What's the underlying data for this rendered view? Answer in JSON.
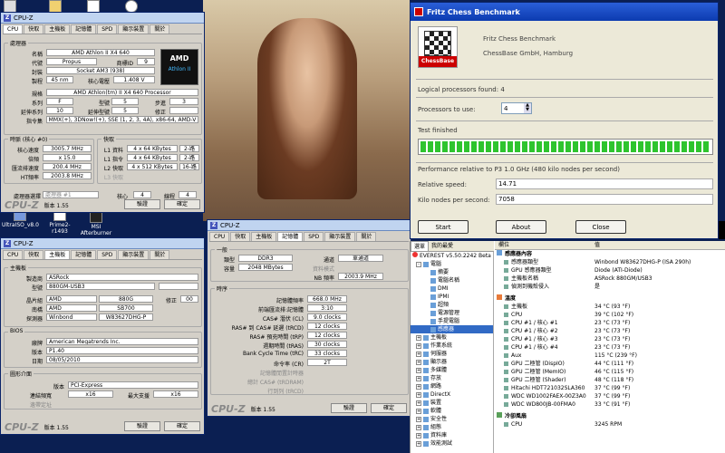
{
  "desktop": {
    "icons": [
      "UltraISO_v8.0",
      "Prime2-r1493",
      "MSI\nAfterburner"
    ],
    "top_icons": [
      "",
      "",
      "",
      ""
    ]
  },
  "cpuz1": {
    "title": "CPU-Z",
    "tabs": [
      "CPU",
      "快取",
      "主機板",
      "記憶體",
      "SPD",
      "顯示裝置",
      "關於"
    ],
    "proc_title": "處理器",
    "name_l": "名稱",
    "name": "AMD Athlon II X4 640",
    "code_l": "代號",
    "code": "Propus",
    "brand_l": "商標ID",
    "brand": "9",
    "pkg_l": "封裝",
    "pkg": "Socket AM3 (938)",
    "tech_l": "製程",
    "tech": "45 nm",
    "volt_l": "核心電壓",
    "volt": "1.408 V",
    "spec_l": "規格",
    "spec": "AMD Athlon(tm) II X4 640 Processor",
    "fam_l": "系列",
    "fam": "F",
    "model_l": "型號",
    "model": "5",
    "step_l": "步進",
    "step": "3",
    "efam_l": "延伸系列",
    "efam": "10",
    "emod_l": "延伸型號",
    "emod": "5",
    "rev_l": "修正",
    "rev": "",
    "inst_l": "指令集",
    "inst": "MMX(+), 3DNow!(+), SSE (1, 2, 3, 4A), x86-64, AMD-V",
    "clk_title": "時脈 (核心 #0)",
    "cs_l": "核心速度",
    "cs": "3005.7 MHz",
    "mult_l": "倍頻",
    "mult": "x 15.0",
    "bus_l": "匯流排速度",
    "bus": "200.4 MHz",
    "ht_l": "HT頻率",
    "ht": "2003.8 MHz",
    "cache_title": "快取",
    "l1d_l": "L1 資料",
    "l1d": "4 x 64 KBytes",
    "l1d_w": "2-路",
    "l1i_l": "L1 指令",
    "l1i": "4 x 64 KBytes",
    "l1i_w": "2-路",
    "l2_l": "L2 快取",
    "l2": "4 x 512 KBytes",
    "l2_w": "16-路",
    "l3_l": "L3 快取",
    "sel_l": "處理器選擇",
    "sel": "處理器 #1",
    "cores_l": "核心",
    "cores": "4",
    "thr_l": "線程",
    "thr": "4",
    "logo": "CPU-Z",
    "version": "版本 1.55",
    "validate": "驗證",
    "ok": "確定",
    "amd_logo": "AMD",
    "athlon": "Athlon II"
  },
  "cpuz2": {
    "title": "CPU-Z",
    "tabs": [
      "CPU",
      "快取",
      "主機板",
      "記憶體",
      "SPD",
      "顯示裝置",
      "關於"
    ],
    "mb_title": "主機板",
    "mfr_l": "製造商",
    "mfr": "ASRock",
    "model_l": "型號",
    "model": "880GM-USB3",
    "model_r": "",
    "chip_l": "晶片組",
    "chip": "AMD",
    "chip2": "880G",
    "rev_l": "修正",
    "rev": "00",
    "sb_l": "南橋",
    "sb": "AMD",
    "sb2": "SB700",
    "lpc_l": "探測器",
    "lpc": "Winbond",
    "lpc2": "W83627DHG-P",
    "bios_title": "BIOS",
    "brand_l": "廠牌",
    "brand": "American Megatrends Inc.",
    "ver_l": "版本",
    "ver": "P1.40",
    "date_l": "日期",
    "date": "08/05/2010",
    "gi_title": "圖形介面",
    "gv_l": "版本",
    "gv": "PCI-Express",
    "lw_l": "連結頻寬",
    "lw": "x16",
    "mx_l": "最大支援",
    "mx": "x16",
    "sb2_l": "邊帶定址",
    "logo": "CPU-Z",
    "version": "版本 1.55",
    "validate": "驗證",
    "ok": "確定"
  },
  "cpuz3": {
    "title": "CPU-Z",
    "tabs": [
      "CPU",
      "快取",
      "主機板",
      "記憶體",
      "SPD",
      "顯示裝置",
      "關於"
    ],
    "gen_title": "一般",
    "type_l": "類型",
    "type": "DDR3",
    "ch_l": "通道",
    "ch": "單通道",
    "size_l": "容量",
    "size": "2048 MBytes",
    "dc_l": "資料模式",
    "nb_l": "NB 頻率",
    "nb": "2003.9 MHz",
    "tim_title": "時序",
    "dram_l": "記憶體頻率",
    "dram": "668.0 MHz",
    "fsb_l": "前端匯流排:記憶體",
    "fsb": "3:10",
    "cl_l": "CAS# 潛伏 (CL)",
    "cl": "9.0 clocks",
    "rcd_l": "RAS# 到 CAS# 延遲 (tRCD)",
    "rcd": "12 clocks",
    "rp_l": "RAS# 預充時間 (tRP)",
    "rp": "12 clocks",
    "ras_l": "週期時間 (tRAS)",
    "ras": "30 clocks",
    "rc_l": "Bank Cycle Time (tRC)",
    "rc": "33 clocks",
    "cr_l": "命令率 (CR)",
    "cr": "2T",
    "idle_l": "記憶體閒置計時器",
    "tcas_l": "總計 CAS# (tRDRAM)",
    "trcd_l": "行到列 (tRCD)",
    "logo": "CPU-Z",
    "version": "版本 1.55",
    "validate": "驗證",
    "ok": "確定"
  },
  "fritz": {
    "title": "Fritz Chess Benchmark",
    "logo_text": "ChessBase",
    "app_name": "Fritz Chess Benchmark",
    "company": "ChessBase GmbH, Hamburg",
    "logical": "Logical processors found: 4",
    "ptu_l": "Processors to use:",
    "ptu": "4",
    "status": "Test finished",
    "progress": 100,
    "perf": "Performance relative to P3 1.0 GHz (480 kilo nodes per second)",
    "rs_l": "Relative speed:",
    "rs": "14.71",
    "kn_l": "Kilo nodes per second:",
    "kn": "7058",
    "start": "Start",
    "about": "About",
    "close": "Close"
  },
  "everest": {
    "tabs": [
      "選單",
      "我的最愛"
    ],
    "root": "EVEREST v5.50.2242 Beta",
    "tree": [
      {
        "label": "電腦",
        "depth": 1,
        "exp": "-"
      },
      {
        "label": "摘要",
        "depth": 2
      },
      {
        "label": "電腦名稱",
        "depth": 2
      },
      {
        "label": "DMI",
        "depth": 2
      },
      {
        "label": "IPMI",
        "depth": 2
      },
      {
        "label": "超頻",
        "depth": 2
      },
      {
        "label": "電源管理",
        "depth": 2
      },
      {
        "label": "手提電腦",
        "depth": 2
      },
      {
        "label": "感應器",
        "depth": 2,
        "sel": true
      },
      {
        "label": "主機板",
        "depth": 1,
        "exp": "+"
      },
      {
        "label": "作業系統",
        "depth": 1,
        "exp": "+"
      },
      {
        "label": "伺服器",
        "depth": 1,
        "exp": "+"
      },
      {
        "label": "顯示器",
        "depth": 1,
        "exp": "+"
      },
      {
        "label": "多媒體",
        "depth": 1,
        "exp": "+"
      },
      {
        "label": "存放",
        "depth": 1,
        "exp": "+"
      },
      {
        "label": "網路",
        "depth": 1,
        "exp": "+"
      },
      {
        "label": "DirectX",
        "depth": 1,
        "exp": "+"
      },
      {
        "label": "裝置",
        "depth": 1,
        "exp": "+"
      },
      {
        "label": "軟體",
        "depth": 1,
        "exp": "+"
      },
      {
        "label": "安全性",
        "depth": 1,
        "exp": "+"
      },
      {
        "label": "組態",
        "depth": 1,
        "exp": "+"
      },
      {
        "label": "資料庫",
        "depth": 1,
        "exp": "+"
      },
      {
        "label": "效能測試",
        "depth": 1,
        "exp": "+"
      }
    ],
    "col_item": "欄位",
    "col_val": "值",
    "sec1": "感應器內容",
    "rows1": [
      {
        "k": "感應器類型",
        "v": "Winbond W83627DHG-P (ISA 290h)"
      },
      {
        "k": "GPU 感應器類型",
        "v": "Diode (ATI-Diode)"
      },
      {
        "k": "主機板名稱",
        "v": "ASRock 880GM/USB3"
      },
      {
        "k": "偵測到機殼侵入",
        "v": "是"
      }
    ],
    "sec2": "溫度",
    "rows2": [
      {
        "k": "主機板",
        "v": "34 °C (93 °F)"
      },
      {
        "k": "CPU",
        "v": "39 °C (102 °F)"
      },
      {
        "k": "CPU #1 / 核心 #1",
        "v": "23 °C (73 °F)"
      },
      {
        "k": "CPU #1 / 核心 #2",
        "v": "23 °C (73 °F)"
      },
      {
        "k": "CPU #1 / 核心 #3",
        "v": "23 °C (73 °F)"
      },
      {
        "k": "CPU #1 / 核心 #4",
        "v": "23 °C (73 °F)"
      },
      {
        "k": "Aux",
        "v": "115 °C (239 °F)"
      },
      {
        "k": "GPU 二極管 (DispIO)",
        "v": "44 °C (111 °F)"
      },
      {
        "k": "GPU 二極管 (MemIO)",
        "v": "46 °C (115 °F)"
      },
      {
        "k": "GPU 二極管 (Shader)",
        "v": "48 °C (118 °F)"
      },
      {
        "k": "Hitachi HDT721032SLA360",
        "v": "37 °C (99 °F)"
      },
      {
        "k": "WDC WD1002FAEX-00Z3A0",
        "v": "37 °C (99 °F)"
      },
      {
        "k": "WDC WD800JB-00FMA0",
        "v": "33 °C (91 °F)"
      }
    ],
    "sec3": "冷卻風扇",
    "rows3": [
      {
        "k": "CPU",
        "v": "3245 RPM"
      }
    ]
  }
}
